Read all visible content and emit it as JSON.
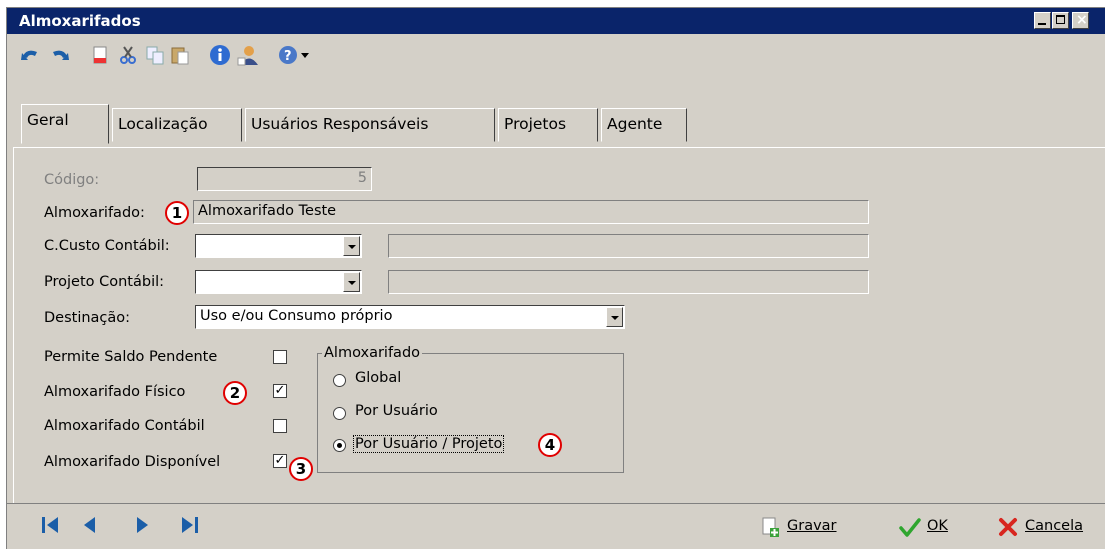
{
  "window": {
    "title": "Almoxarifados"
  },
  "toolbar": {
    "icons": [
      "undo-icon",
      "redo-icon",
      "new-doc-icon",
      "cut-icon",
      "copy-icon",
      "paste-icon",
      "info-icon",
      "user-icon",
      "help-icon",
      "dropdown-arrow-icon"
    ]
  },
  "tabs": [
    {
      "label": "Geral",
      "active": true
    },
    {
      "label": "Localização",
      "active": false
    },
    {
      "label": "Usuários Responsáveis",
      "active": false
    },
    {
      "label": "Projetos",
      "active": false
    },
    {
      "label": "Agente",
      "active": false
    }
  ],
  "form": {
    "codigo_label": "Código:",
    "codigo_value": "5",
    "almoxarifado_label": "Almoxarifado:",
    "almoxarifado_value": "Almoxarifado Teste",
    "ccusto_label": "C.Custo Contábil:",
    "ccusto_value": "",
    "projeto_label": "Projeto Contábil:",
    "projeto_value": "",
    "destinacao_label": "Destinação:",
    "destinacao_value": "Uso e/ou Consumo próprio"
  },
  "checkboxes": [
    {
      "label": "Permite Saldo Pendente",
      "checked": false
    },
    {
      "label": "Almoxarifado Físico",
      "checked": true
    },
    {
      "label": "Almoxarifado Contábil",
      "checked": false
    },
    {
      "label": "Almoxarifado Disponível",
      "checked": true
    }
  ],
  "radio_group": {
    "title": "Almoxarifado",
    "options": [
      {
        "label": "Global",
        "selected": false
      },
      {
        "label": "Por Usuário",
        "selected": false
      },
      {
        "label": "Por Usuário / Projeto",
        "selected": true
      }
    ]
  },
  "badges": [
    "1",
    "2",
    "3",
    "4"
  ],
  "bottom": {
    "save_label": "Gravar",
    "ok_label": "OK",
    "cancel_label": "Cancela"
  },
  "colors": {
    "titlebar": "#0a246a",
    "face": "#d4d0c8",
    "badge_border": "#e00000"
  }
}
